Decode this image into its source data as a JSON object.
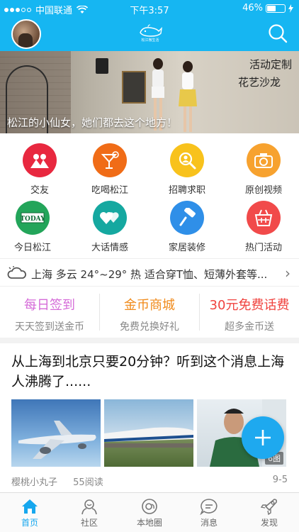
{
  "status_bar": {
    "carrier": "中国联通",
    "time": "下午3:57",
    "battery": "46%",
    "battery_level": 0.46
  },
  "header": {
    "logo_text": "松江微生活",
    "avatar": "user-avatar",
    "search_icon": "search-icon"
  },
  "banner": {
    "caption": "松江的小仙女，她们都去这个地方！",
    "tag_line1": "活动定制",
    "tag_line2": "花艺沙龙"
  },
  "grid": [
    {
      "label": "交友",
      "icon": "friends-icon",
      "color": "#e8283f"
    },
    {
      "label": "吃喝松江",
      "icon": "cocktail-icon",
      "color": "#f06c17"
    },
    {
      "label": "招聘求职",
      "icon": "job-search-icon",
      "color": "#f8c21c"
    },
    {
      "label": "原创视频",
      "icon": "camera-icon",
      "color": "#f7a22f"
    },
    {
      "label": "今日松江",
      "icon": "today-icon",
      "color": "#23a55a"
    },
    {
      "label": "大话情感",
      "icon": "hearts-icon",
      "color": "#15a8a0"
    },
    {
      "label": "家居装修",
      "icon": "paint-roller-icon",
      "color": "#2f8fe8"
    },
    {
      "label": "热门活动",
      "icon": "basket-icon",
      "color": "#f14a4a"
    }
  ],
  "today_badge": "TODAY",
  "weather": {
    "text": "上海 多云 24°~29° 热 适合穿T恤、短薄外套等..."
  },
  "promos": [
    {
      "title": "每日签到",
      "subtitle": "天天签到送金币",
      "color": "#d56bd8"
    },
    {
      "title": "金币商城",
      "subtitle": "免费兑换好礼",
      "color": "#f08a1a"
    },
    {
      "title": "30元免费话费",
      "subtitle": "超多金币送",
      "color": "#f0433f"
    }
  ],
  "article": {
    "title": "从上海到北京只要20分钟？听到这个消息上海人沸腾了......",
    "author": "樱桃小丸子",
    "reads": "55阅读",
    "date": "9-5",
    "image_count": "6图"
  },
  "nav": [
    {
      "label": "首页",
      "icon": "home-icon",
      "active": true
    },
    {
      "label": "社区",
      "icon": "community-icon",
      "active": false
    },
    {
      "label": "本地圈",
      "icon": "local-circle-icon",
      "active": false
    },
    {
      "label": "消息",
      "icon": "message-icon",
      "active": false
    },
    {
      "label": "发现",
      "icon": "rocket-icon",
      "active": false
    }
  ],
  "colors": {
    "brand": "#16b6f2",
    "fab": "#1ea9ef",
    "nav_active": "#16a7ee"
  }
}
